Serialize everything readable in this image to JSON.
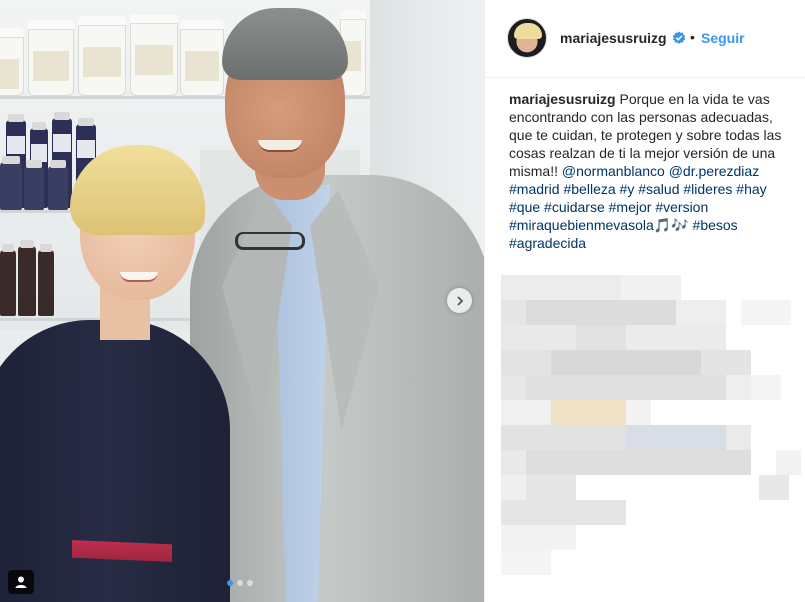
{
  "post": {
    "image": {
      "carousel": {
        "total_slides": 3,
        "active_index": 0
      },
      "icons": {
        "next": "chevron-right-icon",
        "tagged_people": "person-icon"
      }
    },
    "header": {
      "username": "mariajesusruizg",
      "verified": true,
      "separator": "•",
      "follow_label": "Seguir"
    },
    "caption": {
      "username": "mariajesusruizg",
      "text": "Porque en la vida te vas encontrando con las personas adecuadas, que te cuidan, te protegen y sobre todas las cosas realzan de ti la mejor versión de una misma!!",
      "mentions": [
        "@normanblanco",
        "@dr.perezdiaz"
      ],
      "hashtags_line1": [
        "#madrid",
        "#belleza",
        "#y",
        "#salud",
        "#lideres",
        "#hay",
        "#que",
        "#cuidarse",
        "#mejor",
        "#version"
      ],
      "hashtag_music": "#miraquebienmevasola",
      "music_emoji": "🎵🎶",
      "hashtags_line2": [
        "#besos",
        "#agradecida"
      ]
    },
    "colors": {
      "accent": "#3897f0",
      "hashtag": "#003569",
      "text": "#262626",
      "dress": "#272b44",
      "belt": "#c0304c"
    }
  }
}
